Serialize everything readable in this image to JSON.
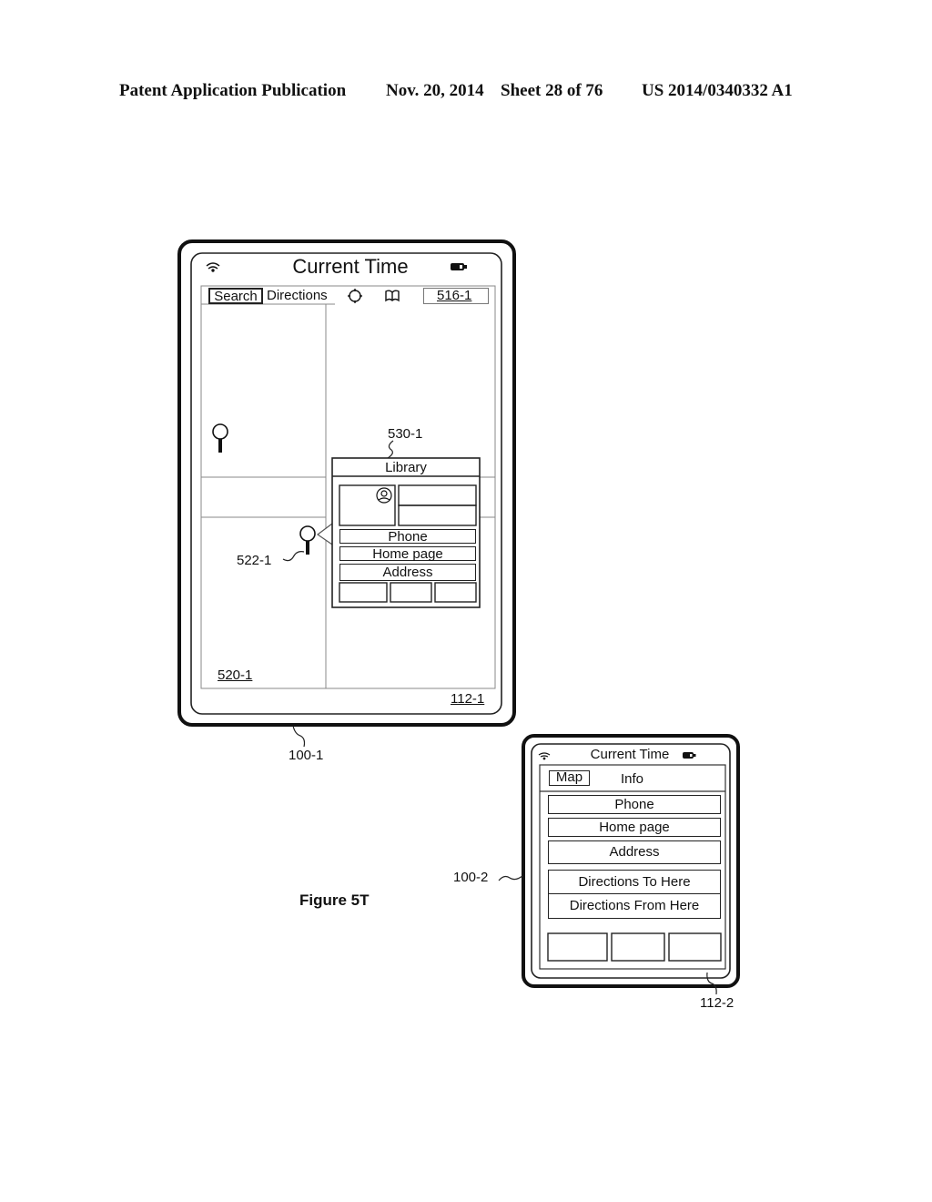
{
  "header": {
    "publication": "Patent Application Publication",
    "date": "Nov. 20, 2014",
    "sheet": "Sheet 28 of 76",
    "patent_number": "US 2014/0340332 A1"
  },
  "figure_label": "Figure 5T",
  "device1": {
    "ref": "100-1",
    "screen_ref": "112-1",
    "title": "Current Time",
    "tabs": {
      "search": "Search",
      "directions": "Directions"
    },
    "icons": [
      "wifi-icon",
      "battery-icon",
      "locate-icon",
      "bookmarks-icon",
      "search-icon"
    ],
    "search_field_value": "516-1",
    "map_ref": "520-1",
    "pin_ref": "522-1",
    "callout": {
      "ref": "530-1",
      "title": "Library",
      "buttons": [
        "Phone",
        "Home page",
        "Address"
      ]
    }
  },
  "device2": {
    "ref": "100-2",
    "screen_ref": "112-2",
    "title": "Current Time",
    "tabs": {
      "map": "Map",
      "info": "Info"
    },
    "buttons": [
      "Phone",
      "Home page",
      "Address"
    ],
    "direction_buttons": [
      "Directions To Here",
      "Directions From Here"
    ]
  }
}
